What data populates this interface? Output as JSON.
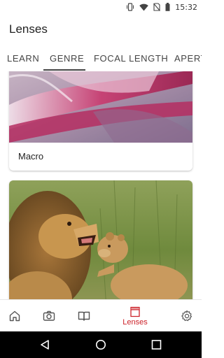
{
  "status_bar": {
    "time": "15:32",
    "icons": [
      "vibrate-icon",
      "wifi-icon",
      "no-sim-icon",
      "battery-icon"
    ]
  },
  "header": {
    "title": "Lenses"
  },
  "tabs": [
    {
      "label": "LEARN"
    },
    {
      "label": "GENRE",
      "selected": true
    },
    {
      "label": "FOCAL LENGTH"
    },
    {
      "label": "APERT"
    }
  ],
  "cards": [
    {
      "label": "Macro",
      "image": "pink flower petals close-up"
    },
    {
      "label": "",
      "image": "lion and cub in grass"
    }
  ],
  "bottom_nav": {
    "items": [
      {
        "icon": "home-icon",
        "label": ""
      },
      {
        "icon": "camera-icon",
        "label": ""
      },
      {
        "icon": "book-icon",
        "label": ""
      },
      {
        "icon": "lenses-icon",
        "label": "Lenses",
        "active": true
      },
      {
        "icon": "gear-icon",
        "label": ""
      }
    ]
  },
  "colors": {
    "accent": "#cc2229",
    "tab_underline": "#444444",
    "system_nav": "#000000"
  }
}
